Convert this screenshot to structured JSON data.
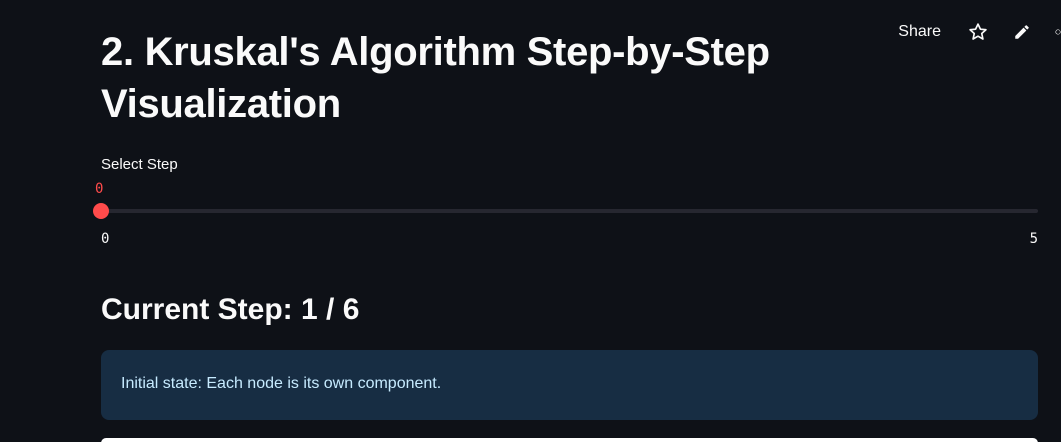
{
  "toolbar": {
    "share_label": "Share",
    "icons": [
      "star-icon",
      "pencil-icon",
      "github-icon"
    ]
  },
  "page": {
    "title": "2. Kruskal's Algorithm Step-by-Step Visualization"
  },
  "slider": {
    "label": "Select Step",
    "value": "0",
    "min": "0",
    "max": "5",
    "fraction": 0.0
  },
  "step": {
    "header": "Current Step: 1 / 6"
  },
  "info": {
    "text": "Initial state: Each node is its own component."
  },
  "colors": {
    "background": "#0e1117",
    "accent": "#ff4b4b",
    "track": "#262730",
    "info_bg": "#172d43",
    "info_text": "#c7ebff"
  }
}
